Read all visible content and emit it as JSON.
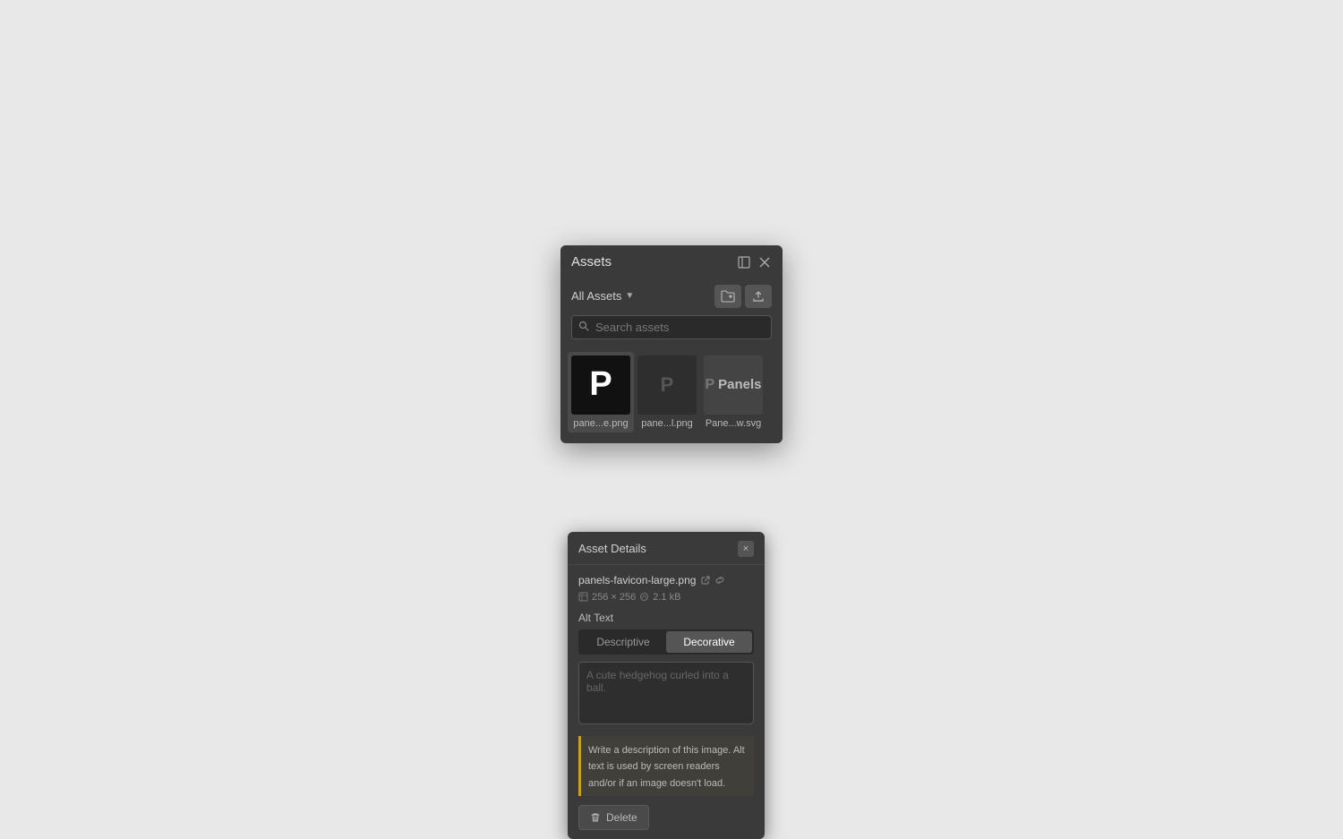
{
  "panel": {
    "title": "Assets",
    "toolbar": {
      "filter_label": "All Assets",
      "add_folder_label": "Add folder",
      "upload_label": "Upload"
    },
    "search": {
      "placeholder": "Search assets"
    },
    "assets": [
      {
        "id": "asset-1",
        "label": "pane...e.png",
        "type": "large-p",
        "selected": true
      },
      {
        "id": "asset-2",
        "label": "pane...l.png",
        "type": "small-p"
      },
      {
        "id": "asset-3",
        "label": "Pane...w.svg",
        "type": "panels-svg"
      }
    ]
  },
  "details": {
    "title": "Asset Details",
    "close_label": "×",
    "file_name": "panels-favicon-large.png",
    "dimensions": "256 × 256",
    "file_size": "2.1 kB",
    "alt_text_label": "Alt Text",
    "tabs": [
      {
        "id": "descriptive",
        "label": "Descriptive",
        "active": false
      },
      {
        "id": "decorative",
        "label": "Decorative",
        "active": true
      }
    ],
    "textarea_placeholder": "A cute hedgehog curled into a ball.",
    "hint_text": "Write a description of this image. Alt text is used by screen readers and/or if an image doesn't load.",
    "delete_label": "Delete"
  },
  "icons": {
    "expand": "⊡",
    "close": "✕",
    "add_folder": "🗂",
    "upload": "↑",
    "search": "🔍",
    "external_link": "↗",
    "link": "🔗",
    "dimensions": "⇔",
    "file": "📄",
    "trash": "🗑"
  }
}
